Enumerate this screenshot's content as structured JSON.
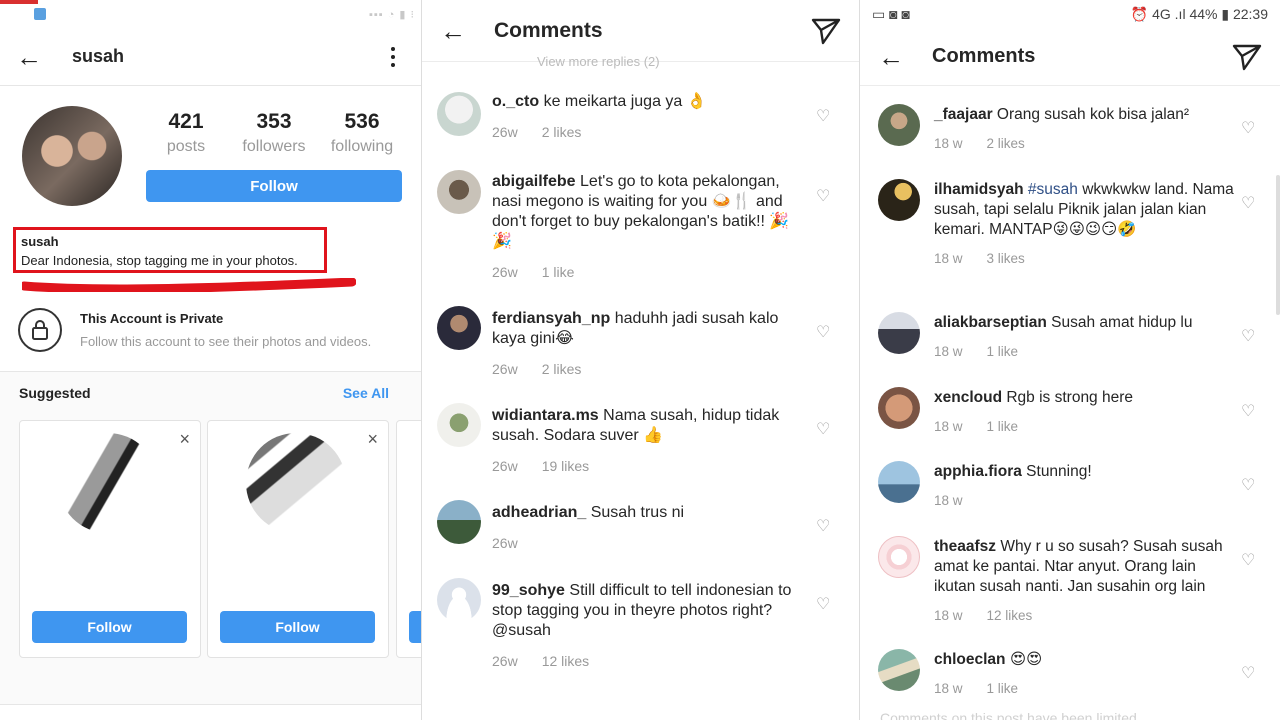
{
  "profile_screen": {
    "username": "susah",
    "stats": [
      {
        "num": "421",
        "label": "posts"
      },
      {
        "num": "353",
        "label": "followers"
      },
      {
        "num": "536",
        "label": "following"
      }
    ],
    "follow_label": "Follow",
    "bio_name": "susah",
    "bio_text": "Dear Indonesia, stop tagging me in your photos.",
    "private_title": "This Account is Private",
    "private_sub": "Follow this account to see their photos and videos.",
    "suggested_label": "Suggested",
    "see_all": "See All",
    "card_follow": "Follow",
    "close_glyph": "×"
  },
  "comments_a": {
    "title": "Comments",
    "view_more": "View more replies (2)",
    "items": [
      {
        "user": "o._cto",
        "text": "ke meikarta juga ya 👌",
        "time": "26w",
        "likes": "2 likes"
      },
      {
        "user": "abigailfebe",
        "text": "Let's go to kota pekalongan, nasi megono is waiting for you 🍛🍴 and don't forget to buy pekalongan's batik!! 🎉🎉",
        "time": "26w",
        "likes": "1 like"
      },
      {
        "user": "ferdiansyah_np",
        "text": "haduhh jadi susah kalo kaya gini😂",
        "time": "26w",
        "likes": "2 likes"
      },
      {
        "user": "widiantara.ms",
        "text": "Nama susah, hidup tidak susah. Sodara suver 👍",
        "time": "26w",
        "likes": "19 likes"
      },
      {
        "user": "adheadrian_",
        "text": "Susah trus ni",
        "time": "26w",
        "likes": ""
      },
      {
        "user": "99_sohye",
        "text": "Still difficult to tell indonesian to stop tagging you in theyre photos right? @susah",
        "time": "26w",
        "likes": "12 likes"
      }
    ]
  },
  "comments_b": {
    "status_right": "⏰ 4G .ıl 44% ▮ 22:39",
    "title": "Comments",
    "items": [
      {
        "user": "_faajaar",
        "text": "Orang susah kok bisa jalan²",
        "time": "18 w",
        "likes": "2 likes"
      },
      {
        "user": "ilhamidsyah",
        "hashtag": "#susah",
        "text": "wkwkwkw land. Nama susah, tapi selalu Piknik jalan jalan kian kemari. MANTAP😜😜😉😏🤣",
        "time": "18 w",
        "likes": "3 likes"
      },
      {
        "user": "aliakbarseptian",
        "text": "Susah amat hidup lu",
        "time": "18 w",
        "likes": "1 like"
      },
      {
        "user": "xencloud",
        "text": "Rgb is strong here",
        "time": "18 w",
        "likes": "1 like"
      },
      {
        "user": "apphia.fiora",
        "text": "Stunning!",
        "time": "18 w",
        "likes": ""
      },
      {
        "user": "theaafsz",
        "text": "Why r u so susah? Susah susah amat ke pantai. Ntar anyut. Orang lain ikutan susah nanti. Jan susahin org lain",
        "time": "18 w",
        "likes": "12 likes"
      },
      {
        "user": "chloeclan",
        "text": "😍😍",
        "time": "18 w",
        "likes": "1 like"
      }
    ],
    "footer_faded": "Comments on this post have been limited"
  }
}
